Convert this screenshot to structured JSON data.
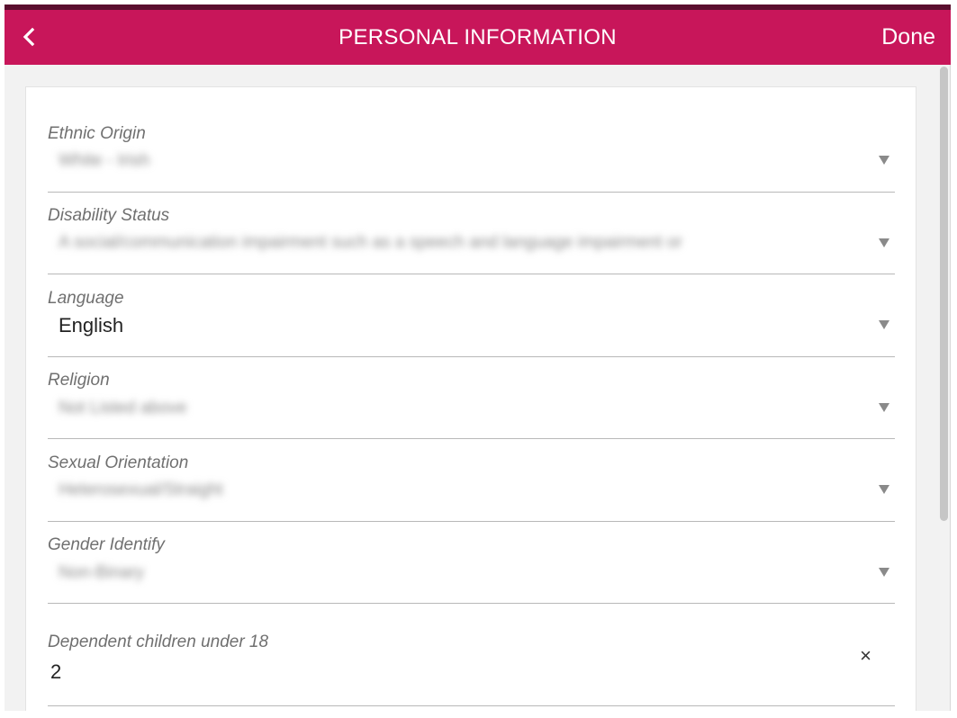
{
  "header": {
    "title": "PERSONAL INFORMATION",
    "done_label": "Done",
    "back_icon": "chevron-left-icon",
    "bg_color": "#c8165a",
    "stripe_color": "#5a0f2e"
  },
  "fields": [
    {
      "label": "Ethnic Origin",
      "value": "White - Irish"
    },
    {
      "label": "Disability Status",
      "value": "A social/communication impairment such as a speech and language impairment or"
    },
    {
      "label": "Language",
      "value": "English"
    },
    {
      "label": "Religion",
      "value": "Not Listed above"
    },
    {
      "label": "Sexual Orientation",
      "value": "Heterosexual/Straight"
    },
    {
      "label": "Gender Identify",
      "value": "Non-Binary"
    },
    {
      "label": "Dependent children under 18",
      "value": "2"
    }
  ]
}
